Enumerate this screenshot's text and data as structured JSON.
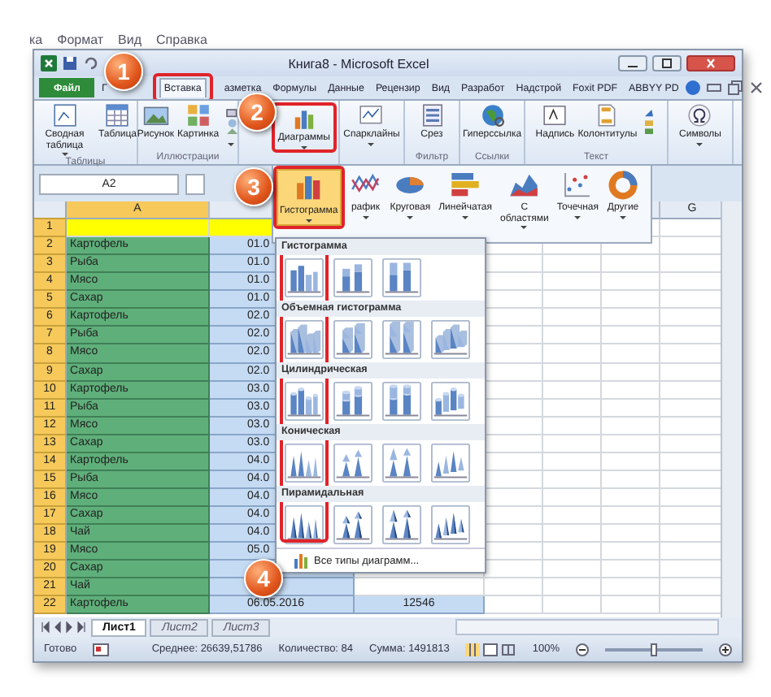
{
  "menu_bar": [
    "ка",
    "Формат",
    "Вид",
    "Справка"
  ],
  "window": {
    "title": "Книга8 - Microsoft Excel"
  },
  "ribbon_tabs": [
    {
      "label": "Файл",
      "kind": "file",
      "selected": false
    },
    {
      "label": "Г",
      "kind": "tab",
      "selected": false
    },
    {
      "label": "Вставка",
      "kind": "tab",
      "selected": true
    },
    {
      "label": "азметка",
      "kind": "tab",
      "selected": false
    },
    {
      "label": "Формулы",
      "kind": "tab",
      "selected": false
    },
    {
      "label": "Данные",
      "kind": "tab",
      "selected": false
    },
    {
      "label": "Рецензир",
      "kind": "tab",
      "selected": false
    },
    {
      "label": "Вид",
      "kind": "tab",
      "selected": false
    },
    {
      "label": "Разработ",
      "kind": "tab",
      "selected": false
    },
    {
      "label": "Надстрой",
      "kind": "tab",
      "selected": false
    },
    {
      "label": "Foxit PDF",
      "kind": "tab",
      "selected": false
    },
    {
      "label": "ABBYY PD",
      "kind": "tab",
      "selected": false
    }
  ],
  "ribbon_groups": [
    {
      "label": "Таблицы",
      "buttons": [
        {
          "label": "Сводная таблица",
          "kind": "pivot",
          "dropdown": true
        },
        {
          "label": "Таблица",
          "kind": "table",
          "dropdown": false
        }
      ]
    },
    {
      "label": "Иллюстрации",
      "buttons": [
        {
          "label": "Рисунок",
          "kind": "picture",
          "dropdown": false
        },
        {
          "label": "Картинка",
          "kind": "clipart",
          "dropdown": false
        },
        {
          "kind": "shapes",
          "dropdown": true
        }
      ]
    },
    {
      "buttons": [
        {
          "label": "Диаграммы",
          "kind": "chart",
          "dropdown": true
        }
      ]
    },
    {
      "buttons": [
        {
          "label": "Спарклайны",
          "kind": "sparkline",
          "dropdown": true
        }
      ]
    },
    {
      "label": "Фильтр",
      "buttons": [
        {
          "label": "Срез",
          "kind": "slicer",
          "dropdown": false
        }
      ]
    },
    {
      "label": "Ссылки",
      "buttons": [
        {
          "label": "Гиперссылка",
          "kind": "hyperlink",
          "dropdown": false
        }
      ]
    },
    {
      "label": "Текст",
      "buttons": [
        {
          "label": "Надпись",
          "kind": "textbox",
          "dropdown": false
        },
        {
          "label": "Колонтитулы",
          "kind": "header",
          "dropdown": false
        },
        {
          "kind": "texttools",
          "dropdown": false
        }
      ]
    },
    {
      "buttons": [
        {
          "label": "Символы",
          "kind": "symbol",
          "dropdown": true
        }
      ]
    }
  ],
  "formula_bar": {
    "name_box": "A2"
  },
  "column_headers": [
    "A",
    "G"
  ],
  "rows": [
    {
      "number": "1",
      "kind": "header"
    },
    {
      "number": "2",
      "product": "Картофель",
      "date": "01.0"
    },
    {
      "number": "3",
      "product": "Рыба",
      "date": "01.0"
    },
    {
      "number": "4",
      "product": "Мясо",
      "date": "01.0"
    },
    {
      "number": "5",
      "product": "Сахар",
      "date": "01.0"
    },
    {
      "number": "6",
      "product": "Картофель",
      "date": "02.0"
    },
    {
      "number": "7",
      "product": "Рыба",
      "date": "02.0"
    },
    {
      "number": "8",
      "product": "Мясо",
      "date": "02.0"
    },
    {
      "number": "9",
      "product": "Сахар",
      "date": "02.0"
    },
    {
      "number": "10",
      "product": "Картофель",
      "date": "03.0"
    },
    {
      "number": "11",
      "product": "Рыба",
      "date": "03.0"
    },
    {
      "number": "12",
      "product": "Мясо",
      "date": "03.0"
    },
    {
      "number": "13",
      "product": "Сахар",
      "date": "03.0"
    },
    {
      "number": "14",
      "product": "Картофель",
      "date": "04.0"
    },
    {
      "number": "15",
      "product": "Рыба",
      "date": "04.0"
    },
    {
      "number": "16",
      "product": "Мясо",
      "date": "04.0"
    },
    {
      "number": "17",
      "product": "Сахар",
      "date": "04.0"
    },
    {
      "number": "18",
      "product": "Чай",
      "date": "04.0"
    },
    {
      "number": "19",
      "product": "Мясо",
      "date": "05.0"
    },
    {
      "number": "20",
      "product": "Сахар"
    },
    {
      "number": "21",
      "product": "Чай"
    },
    {
      "number": "22",
      "product": "Картофель",
      "date": "06.05.2016",
      "amount": "12546"
    }
  ],
  "chart_types": [
    {
      "label": "Гистограмма",
      "kind": "column",
      "selected": true
    },
    {
      "label": "рафик",
      "kind": "line",
      "selected": false
    },
    {
      "label": "Круговая",
      "kind": "pie",
      "selected": false
    },
    {
      "label": "Линейчатая",
      "kind": "bar",
      "selected": false
    },
    {
      "label": "С областями",
      "kind": "area",
      "selected": false
    },
    {
      "label": "Точечная",
      "kind": "scatter",
      "selected": false
    },
    {
      "label": "Другие",
      "kind": "other",
      "selected": false
    }
  ],
  "gallery": [
    {
      "title": "Гистограмма",
      "kind": "flat",
      "items": [
        {
          "kind": "clustered"
        },
        {
          "kind": "stacked"
        },
        {
          "kind": "percent"
        }
      ]
    },
    {
      "title": "Объемная гистограмма",
      "kind": "box",
      "items": [
        {
          "kind": "clustered"
        },
        {
          "kind": "stacked"
        },
        {
          "kind": "percent"
        },
        {
          "kind": "deep"
        }
      ]
    },
    {
      "title": "Цилиндрическая",
      "kind": "cylinder",
      "items": [
        {
          "kind": "clustered"
        },
        {
          "kind": "stacked"
        },
        {
          "kind": "percent"
        },
        {
          "kind": "deep"
        }
      ]
    },
    {
      "title": "Коническая",
      "kind": "cone",
      "items": [
        {
          "kind": "clustered"
        },
        {
          "kind": "stacked"
        },
        {
          "kind": "percent"
        },
        {
          "kind": "deep"
        }
      ]
    },
    {
      "title": "Пирамидальная",
      "kind": "pyramid",
      "items": [
        {
          "kind": "clustered"
        },
        {
          "kind": "stacked"
        },
        {
          "kind": "percent"
        },
        {
          "kind": "deep"
        }
      ]
    }
  ],
  "gallery_footer": "Все типы диаграмм...",
  "sheet_tabs": [
    {
      "label": "Лист1",
      "selected": true
    },
    {
      "label": "Лист2",
      "selected": false
    },
    {
      "label": "Лист3",
      "selected": false
    }
  ],
  "status_bar": {
    "ready": "Готово",
    "average": "Среднее: 26639,51786",
    "count": "Количество: 84",
    "sum": "Сумма: 1491813",
    "zoom": "100%",
    "zoom_slider": {
      "level": 0.5
    }
  },
  "callouts": [
    "1",
    "2",
    "3",
    "4"
  ]
}
